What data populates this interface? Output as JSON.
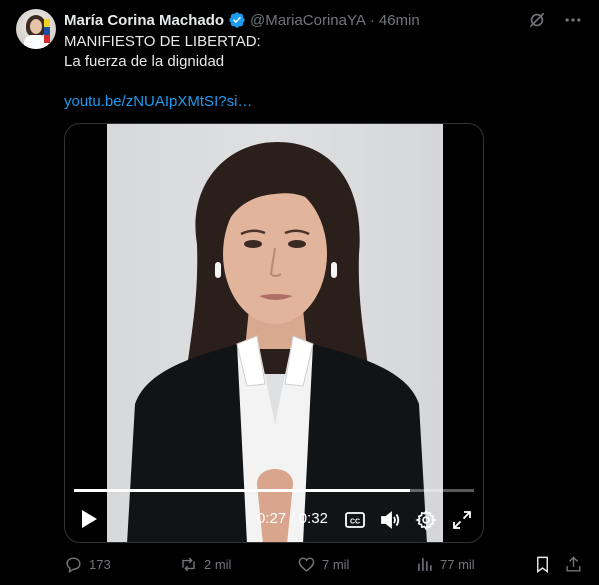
{
  "author": {
    "name": "María Corina Machado",
    "handle": "@MariaCorinaYA",
    "separator": "·",
    "time": "46min"
  },
  "tweet": {
    "line1": "MANIFIESTO DE LIBERTAD:",
    "line2": "La fuerza de la dignidad",
    "link": "youtu.be/zNUAIpXMtSI?si…"
  },
  "video": {
    "progress": 0.84,
    "current_time": "0:27",
    "time_separator": "/",
    "duration": "0:32"
  },
  "actions": {
    "replies": "173",
    "reposts": "2 mil",
    "likes": "7 mil",
    "views": "77 mil"
  },
  "colors": {
    "accent": "#1d9bf0",
    "muted": "#71767b",
    "text": "#e7e9ea",
    "background": "#000000"
  }
}
